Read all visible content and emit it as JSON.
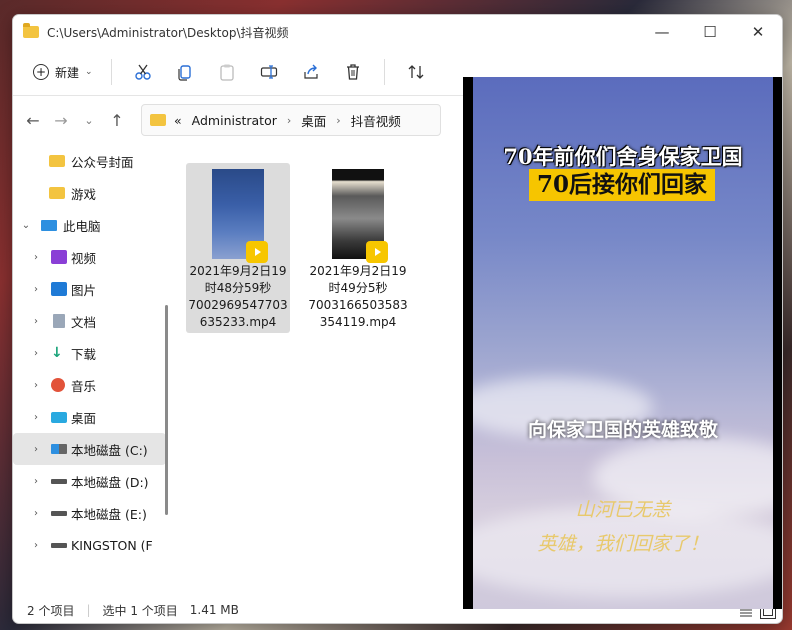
{
  "window": {
    "title": "C:\\Users\\Administrator\\Desktop\\抖音视频"
  },
  "toolbar": {
    "new_label": "新建"
  },
  "address": {
    "prefix": "«",
    "crumbs": [
      "Administrator",
      "桌面",
      "抖音视频"
    ]
  },
  "nav": {
    "items": [
      {
        "label": "公众号封面",
        "icon": "folder-icon"
      },
      {
        "label": "游戏",
        "icon": "folder-icon"
      },
      {
        "label": "此电脑",
        "icon": "pc-icon"
      },
      {
        "label": "视频",
        "icon": "video-icon"
      },
      {
        "label": "图片",
        "icon": "picture-icon"
      },
      {
        "label": "文档",
        "icon": "document-icon"
      },
      {
        "label": "下载",
        "icon": "download-icon"
      },
      {
        "label": "音乐",
        "icon": "music-icon"
      },
      {
        "label": "桌面",
        "icon": "desktop-icon"
      },
      {
        "label": "本地磁盘 (C:)",
        "icon": "drive-icon"
      },
      {
        "label": "本地磁盘 (D:)",
        "icon": "drive-icon"
      },
      {
        "label": "本地磁盘 (E:)",
        "icon": "drive-icon"
      },
      {
        "label": "KINGSTON (F",
        "icon": "drive-icon"
      }
    ]
  },
  "files": [
    {
      "name_lines": [
        "2021年9月2日19",
        "时48分59秒",
        "7002969547703",
        "635233.mp4"
      ],
      "badge": "Player"
    },
    {
      "name_lines": [
        "2021年9月2日19",
        "时49分5秒",
        "7003166503583",
        "354119.mp4"
      ],
      "badge": "Player"
    }
  ],
  "status": {
    "count": "2 个项目",
    "selected": "选中 1 个项目",
    "size": "1.41 MB"
  },
  "preview": {
    "line1": "70年前你们舍身保家卫国",
    "line2": "70后接你们回家",
    "line3": "向保家卫国的英雄致敬",
    "line4": "山河已无恙",
    "line5": "英雄，我们回家了！"
  }
}
